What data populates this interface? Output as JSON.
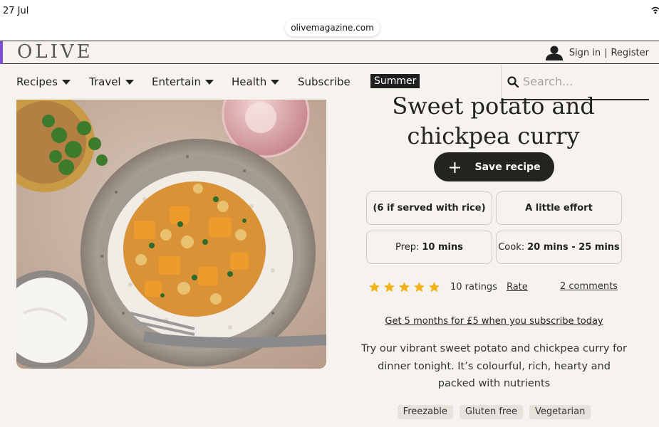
{
  "status": {
    "date": "27 Jul",
    "url": "olivemagazine.com"
  },
  "header": {
    "logo": "OLIVE",
    "sign_in": "Sign in",
    "separator": "|",
    "register": "Register"
  },
  "nav": {
    "items": [
      {
        "label": "Recipes",
        "dropdown": true
      },
      {
        "label": "Travel",
        "dropdown": true
      },
      {
        "label": "Entertain",
        "dropdown": true
      },
      {
        "label": "Health",
        "dropdown": true
      },
      {
        "label": "Subscribe",
        "dropdown": false
      }
    ],
    "summer": "Summer",
    "search_placeholder": "Search..."
  },
  "recipe": {
    "title_line1": "Sweet potato and",
    "title_line2": "chickpea curry",
    "save_label": "Save recipe",
    "serves": "(6 if served with rice)",
    "difficulty": "A little effort",
    "prep_label": "Prep:",
    "prep_value": "10 mins",
    "cook_label": "Cook:",
    "cook_value": "20 mins - 25 mins",
    "star_count": 5,
    "ratings_text": "10 ratings",
    "rate_label": "Rate",
    "comments_label": "2 comments",
    "promo": "Get 5 months for £5 when you subscribe today",
    "description": "Try our vibrant sweet potato and chickpea curry for dinner tonight. It’s colourful, rich, hearty and packed with nutrients",
    "tags": [
      "Freezable",
      "Gluten free",
      "Vegetarian"
    ]
  },
  "colors": {
    "accent_purple": "#7c4fd6",
    "star": "#f2b21a",
    "button_dark": "#23251f"
  }
}
